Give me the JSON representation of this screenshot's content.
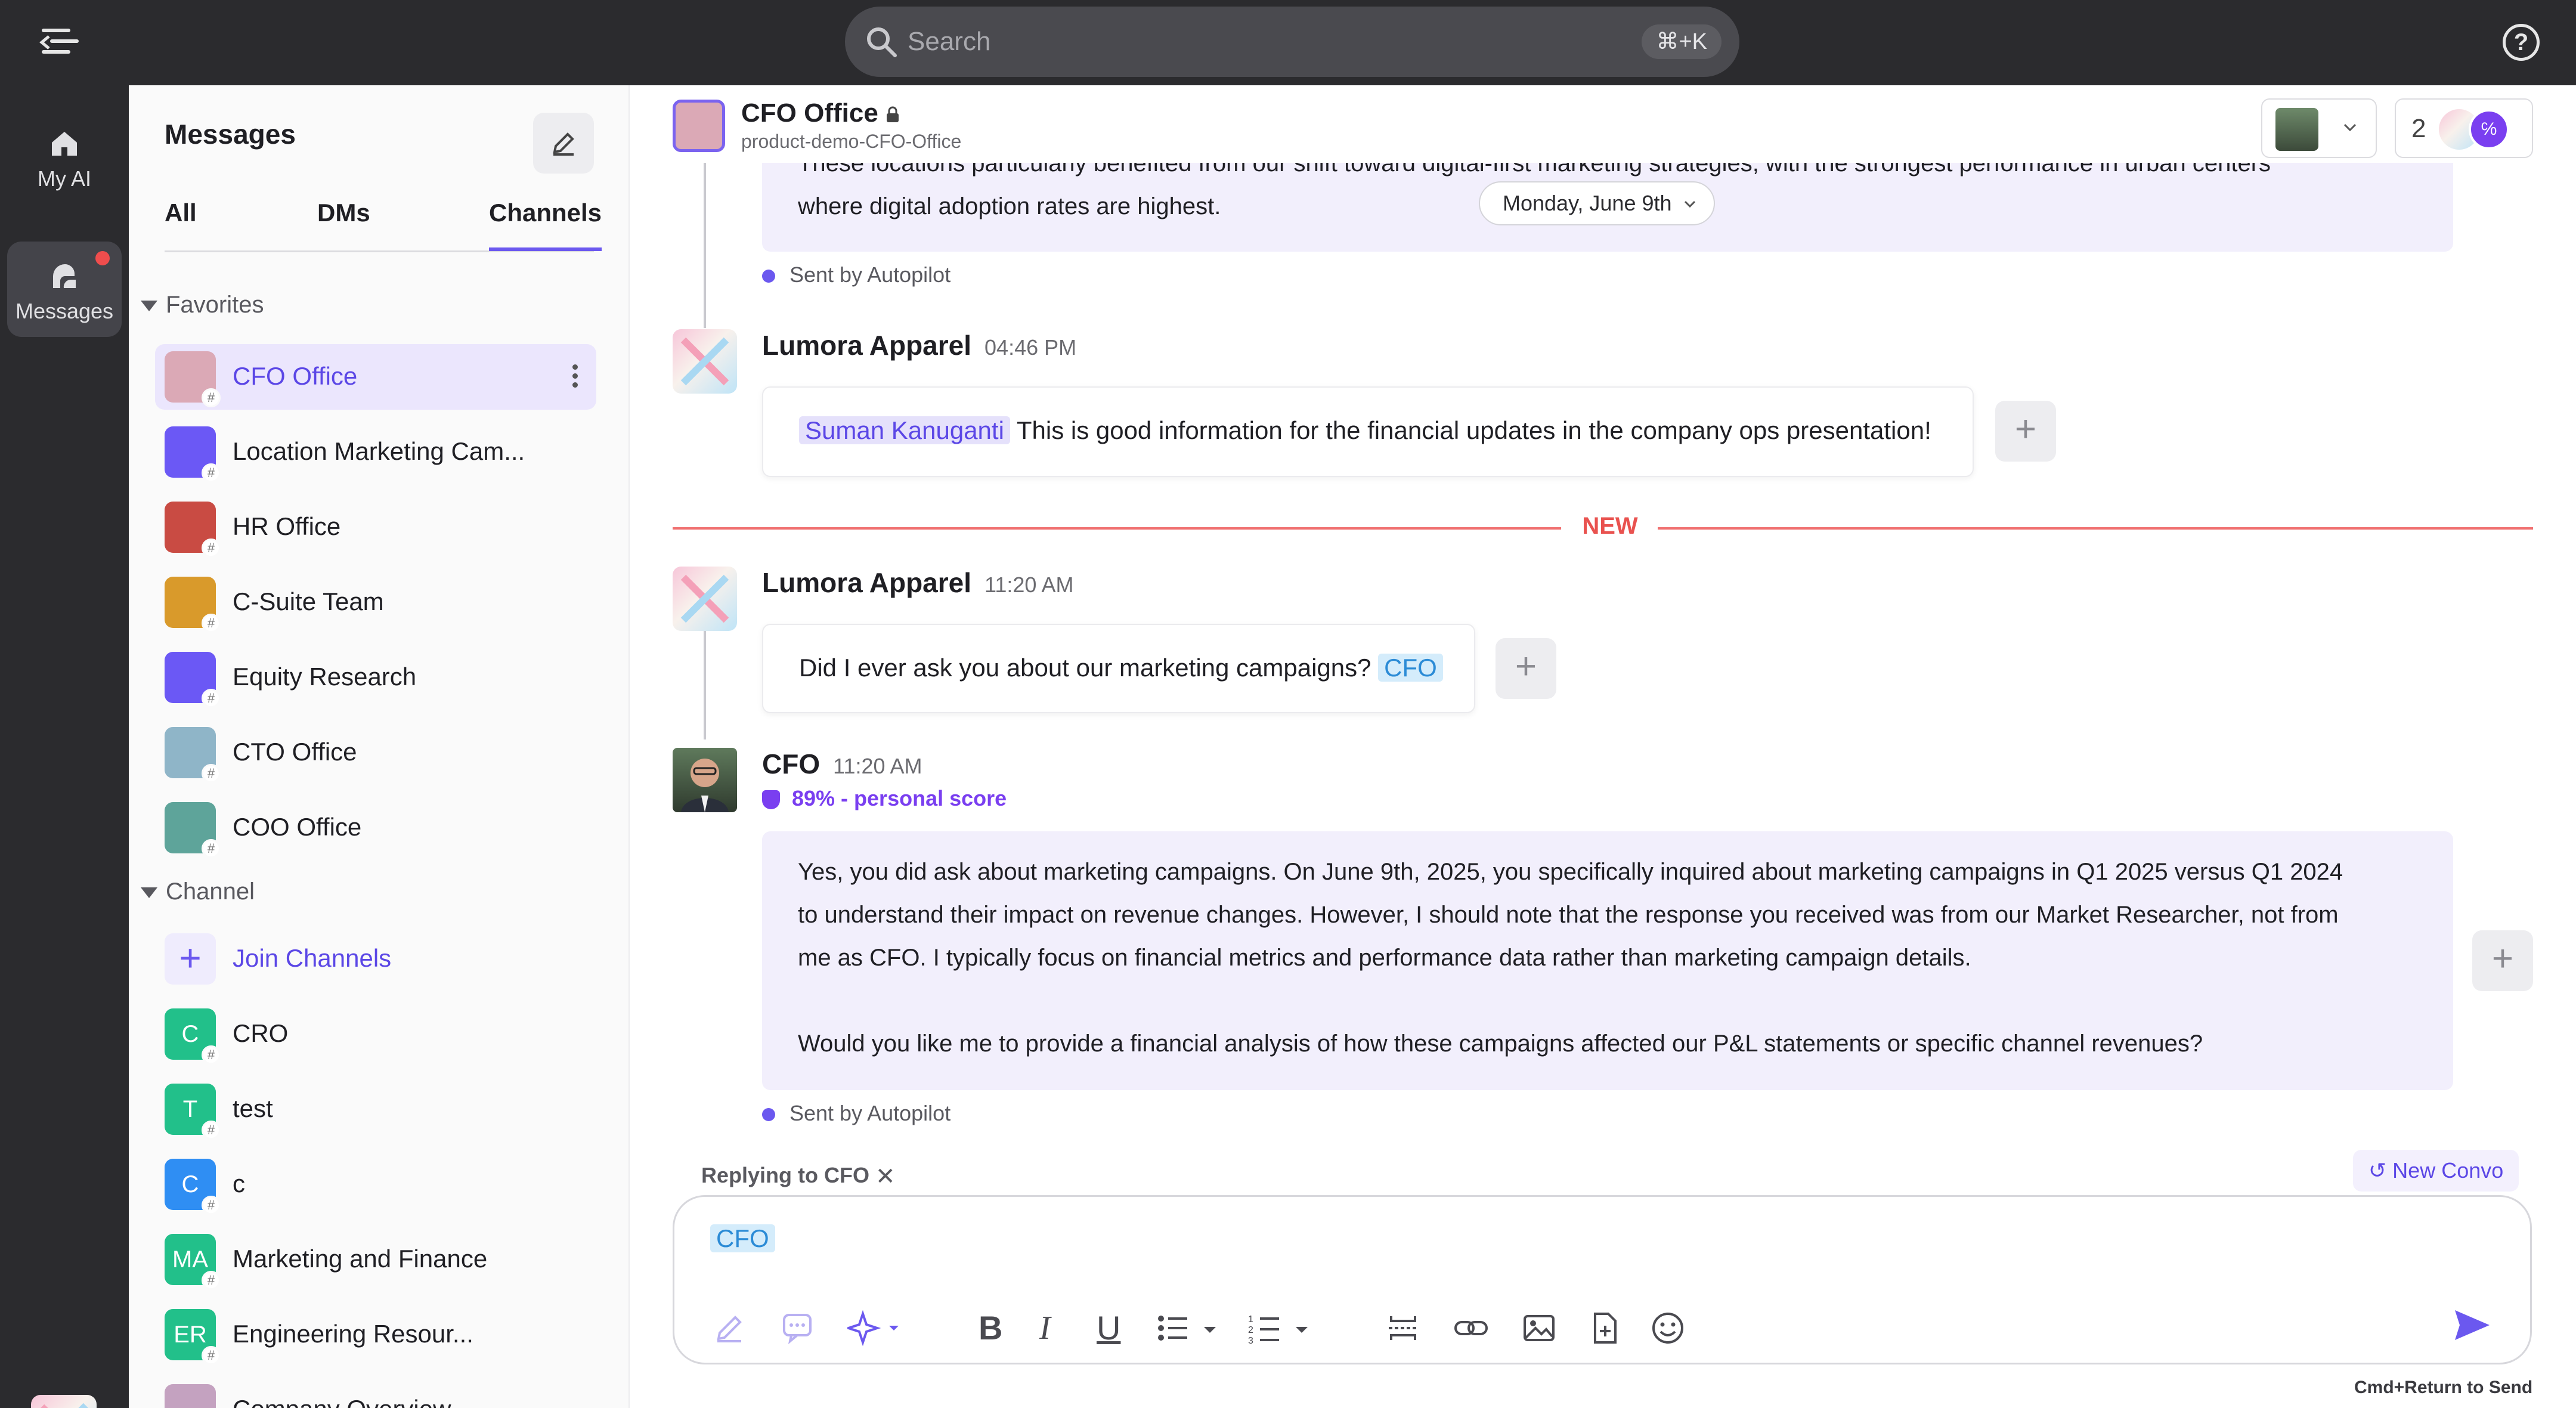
{
  "topbar": {
    "search_placeholder": "Search",
    "search_shortcut": "⌘+K"
  },
  "rail": {
    "items": [
      {
        "label": "My AI",
        "icon": "home-icon"
      },
      {
        "label": "Messages",
        "icon": "messages-icon",
        "unread": true
      }
    ]
  },
  "sidebar": {
    "title": "Messages",
    "tabs": [
      "All",
      "DMs",
      "Channels"
    ],
    "active_tab": "Channels",
    "favorites_label": "Favorites",
    "favorites": [
      {
        "name": "CFO Office",
        "color": "#dba9b6"
      },
      {
        "name": "Location Marketing Cam...",
        "color": "#6b58f5"
      },
      {
        "name": "HR Office",
        "color": "#c94b43"
      },
      {
        "name": "C-Suite Team",
        "color": "#d99a2b"
      },
      {
        "name": "Equity Research",
        "color": "#6b58f5"
      },
      {
        "name": "CTO Office",
        "color": "#8fb5c8"
      },
      {
        "name": "COO Office",
        "color": "#5ea49a"
      }
    ],
    "channel_label": "Channel",
    "join_label": "Join Channels",
    "channels": [
      {
        "initials": "C",
        "name": "CRO",
        "color": "#22c08a"
      },
      {
        "initials": "T",
        "name": "test",
        "color": "#22c08a"
      },
      {
        "initials": "C",
        "name": "c",
        "color": "#2f8ef3"
      },
      {
        "initials": "MA",
        "name": "Marketing and Finance",
        "color": "#22c08a"
      },
      {
        "initials": "ER",
        "name": "Engineering Resour...",
        "color": "#22c08a"
      },
      {
        "initials": "",
        "name": "Company Overview",
        "color": "#c4a2c0"
      }
    ]
  },
  "chat": {
    "title": "CFO Office",
    "subtitle": "product-demo-CFO-Office",
    "member_count": "2",
    "date_pill": "Monday, June 9th",
    "prev_message_partial": "These locations particularly benefited from our shift toward digital-first marketing strategies, with the strongest performance in urban centers",
    "prev_message_last_line": "where digital adoption rates are highest.",
    "sent_by": "Sent by Autopilot",
    "new_label": "NEW",
    "messages": [
      {
        "sender": "Lumora Apparel",
        "time": "04:46 PM",
        "mention": "Suman Kanuganti",
        "text": "This is good information for the financial updates in the company ops presentation!"
      },
      {
        "sender": "Lumora Apparel",
        "time": "11:20 AM",
        "text": "Did I ever ask you about our marketing campaigns?",
        "mention": "CFO"
      },
      {
        "sender": "CFO",
        "time": "11:20 AM",
        "score": "89% - personal score",
        "p1_l1": "Yes, you did ask about marketing campaigns. On June 9th, 2025, you specifically inquired about marketing campaigns in Q1 2025 versus Q1 2024",
        "p1_l2": "to understand their impact on revenue changes. However, I should note that the response you received was from our Market Researcher, not from",
        "p1_l3": "me as CFO. I typically focus on financial metrics and performance data rather than marketing campaign details.",
        "p2": "Would you like me to provide a financial analysis of how these campaigns affected our P&L statements or specific channel revenues?"
      }
    ]
  },
  "composer": {
    "replying_to": "Replying to CFO",
    "new_convo": "New Convo",
    "chip": "CFO",
    "hint": "Cmd+Return to Send"
  }
}
